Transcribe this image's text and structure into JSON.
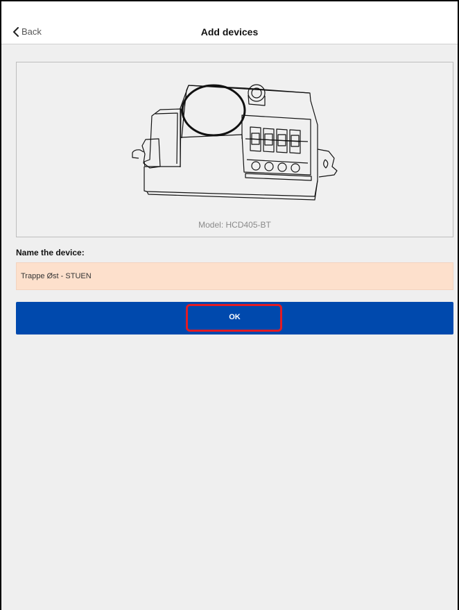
{
  "nav": {
    "back_label": "Back",
    "title": "Add devices",
    "back_icon": "chevron-left-icon"
  },
  "device": {
    "model_text": "Model: HCD405-BT"
  },
  "form": {
    "name_label": "Name the device:",
    "name_value": "Trappe Øst - STUEN",
    "field_color": "#fde0cc"
  },
  "ok_button": {
    "label": "OK",
    "color": "#0049ad",
    "highlight_color": "#e31b23"
  }
}
